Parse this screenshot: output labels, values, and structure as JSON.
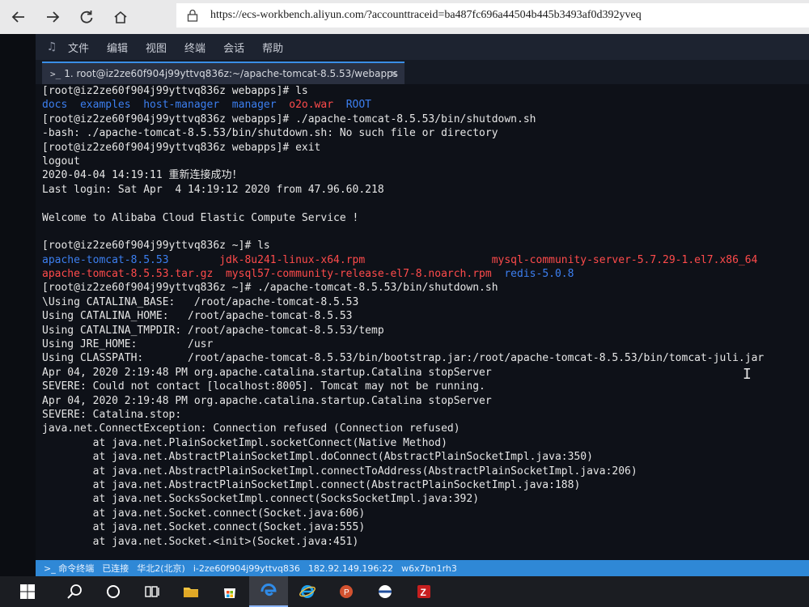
{
  "browser": {
    "url": "https://ecs-workbench.aliyun.com/?accounttraceid=ba487fc696a44504b445b3493af0d392yveq"
  },
  "menu": {
    "items": [
      "文件",
      "编辑",
      "视图",
      "终端",
      "会话",
      "帮助"
    ]
  },
  "tab": {
    "label": "1. root@iz2ze60f904j99yttvq836z:~/apache-tomcat-8.5.53/webapps",
    "close": "×",
    "prompt": ">_"
  },
  "terminal": {
    "lines": [
      [
        {
          "t": "[root@iz2ze60f904j99yttvq836z webapps]# ls",
          "c": "def"
        }
      ],
      [
        {
          "t": "docs  examples  host-manager  manager  ",
          "c": "blue"
        },
        {
          "t": "o2o.war",
          "c": "red"
        },
        {
          "t": "  ROOT",
          "c": "blue"
        }
      ],
      [
        {
          "t": "[root@iz2ze60f904j99yttvq836z webapps]# ./apache-tomcat-8.5.53/bin/shutdown.sh",
          "c": "def"
        }
      ],
      [
        {
          "t": "-bash: ./apache-tomcat-8.5.53/bin/shutdown.sh: No such file or directory",
          "c": "def"
        }
      ],
      [
        {
          "t": "[root@iz2ze60f904j99yttvq836z webapps]# exit",
          "c": "def"
        }
      ],
      [
        {
          "t": "logout",
          "c": "def"
        }
      ],
      [
        {
          "t": "2020-04-04 14:19:11 重新连接成功！",
          "c": "def"
        }
      ],
      [
        {
          "t": "Last login: Sat Apr  4 14:19:12 2020 from 47.96.60.218",
          "c": "def"
        }
      ],
      [
        {
          "t": "",
          "c": "def"
        }
      ],
      [
        {
          "t": "Welcome to Alibaba Cloud Elastic Compute Service !",
          "c": "def"
        }
      ],
      [
        {
          "t": "",
          "c": "def"
        }
      ],
      [
        {
          "t": "[root@iz2ze60f904j99yttvq836z ~]# ls",
          "c": "def"
        }
      ],
      [
        {
          "t": "apache-tomcat-8.5.53        ",
          "c": "blue"
        },
        {
          "t": "jdk-8u241-linux-x64.rpm                    mysql-community-server-5.7.29-1.el7.x86_64",
          "c": "red"
        }
      ],
      [
        {
          "t": "apache-tomcat-8.5.53.tar.gz  mysql57-community-release-el7-8.noarch.rpm  ",
          "c": "red"
        },
        {
          "t": "redis-5.0.8",
          "c": "blue"
        }
      ],
      [
        {
          "t": "[root@iz2ze60f904j99yttvq836z ~]# ./apache-tomcat-8.5.53/bin/shutdown.sh",
          "c": "def"
        }
      ],
      [
        {
          "t": "\\Using CATALINA_BASE:   /root/apache-tomcat-8.5.53",
          "c": "def"
        }
      ],
      [
        {
          "t": "Using CATALINA_HOME:   /root/apache-tomcat-8.5.53",
          "c": "def"
        }
      ],
      [
        {
          "t": "Using CATALINA_TMPDIR: /root/apache-tomcat-8.5.53/temp",
          "c": "def"
        }
      ],
      [
        {
          "t": "Using JRE_HOME:        /usr",
          "c": "def"
        }
      ],
      [
        {
          "t": "Using CLASSPATH:       /root/apache-tomcat-8.5.53/bin/bootstrap.jar:/root/apache-tomcat-8.5.53/bin/tomcat-juli.jar",
          "c": "def"
        }
      ],
      [
        {
          "t": "Apr 04, 2020 2:19:48 PM org.apache.catalina.startup.Catalina stopServer",
          "c": "def"
        }
      ],
      [
        {
          "t": "SEVERE: Could not contact [localhost:8005]. Tomcat may not be running.",
          "c": "def"
        }
      ],
      [
        {
          "t": "Apr 04, 2020 2:19:48 PM org.apache.catalina.startup.Catalina stopServer",
          "c": "def"
        }
      ],
      [
        {
          "t": "SEVERE: Catalina.stop:",
          "c": "def"
        }
      ],
      [
        {
          "t": "java.net.ConnectException: Connection refused (Connection refused)",
          "c": "def"
        }
      ],
      [
        {
          "t": "        at java.net.PlainSocketImpl.socketConnect(Native Method)",
          "c": "def"
        }
      ],
      [
        {
          "t": "        at java.net.AbstractPlainSocketImpl.doConnect(AbstractPlainSocketImpl.java:350)",
          "c": "def"
        }
      ],
      [
        {
          "t": "        at java.net.AbstractPlainSocketImpl.connectToAddress(AbstractPlainSocketImpl.java:206)",
          "c": "def"
        }
      ],
      [
        {
          "t": "        at java.net.AbstractPlainSocketImpl.connect(AbstractPlainSocketImpl.java:188)",
          "c": "def"
        }
      ],
      [
        {
          "t": "        at java.net.SocksSocketImpl.connect(SocksSocketImpl.java:392)",
          "c": "def"
        }
      ],
      [
        {
          "t": "        at java.net.Socket.connect(Socket.java:606)",
          "c": "def"
        }
      ],
      [
        {
          "t": "        at java.net.Socket.connect(Socket.java:555)",
          "c": "def"
        }
      ],
      [
        {
          "t": "        at java.net.Socket.<init>(Socket.java:451)",
          "c": "def"
        }
      ]
    ],
    "cursor": "I"
  },
  "status": {
    "items": [
      ">_ 命令终端",
      "已连接",
      "华北2(北京)",
      "i-2ze60f904j99yttvq836",
      "182.92.149.196:22",
      "w6x7bn1rh3"
    ]
  },
  "colors": {
    "accent": "#2f88d6",
    "dir_blue": "#3c7ff0",
    "archive_red": "#ff4b4b",
    "terminal_bg": "#0e1118"
  },
  "taskbar": {
    "icons": [
      "windows-start-icon",
      "search-icon",
      "cortana-icon",
      "task-view-icon",
      "file-explorer-icon",
      "store-icon",
      "edge-icon",
      "internet-explorer-icon",
      "powerpoint-icon",
      "vpn-client-icon",
      "filezilla-icon"
    ]
  }
}
